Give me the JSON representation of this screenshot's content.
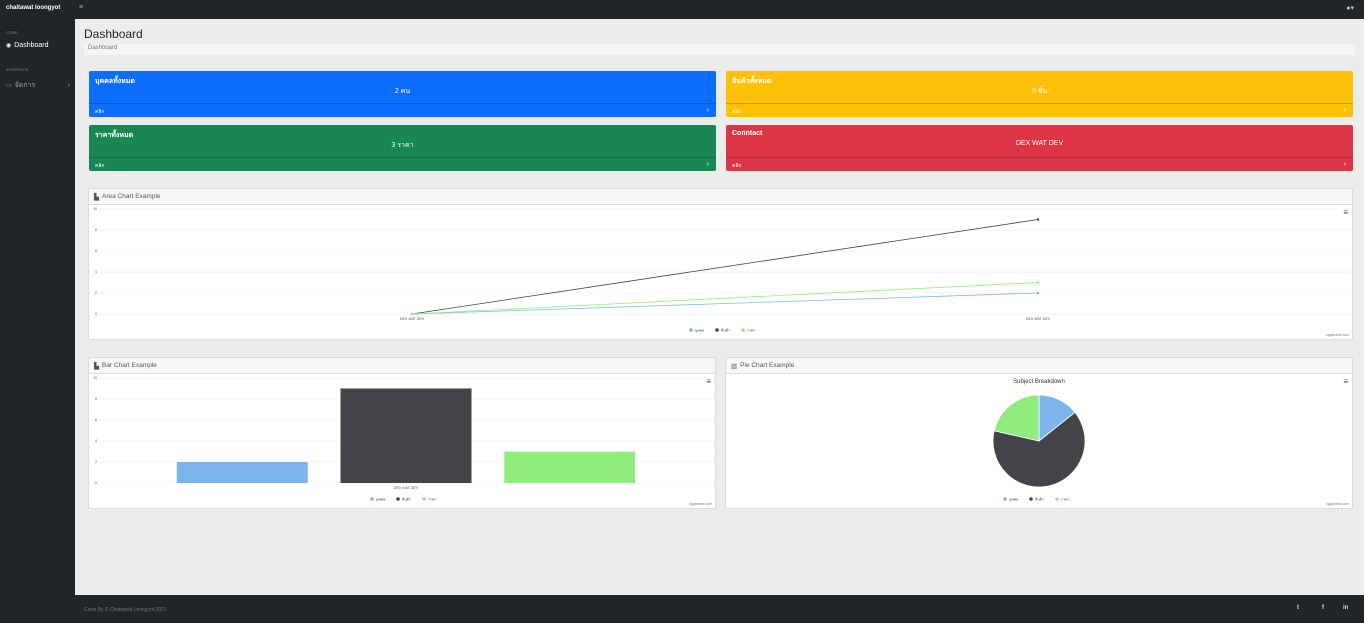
{
  "app": {
    "brand": "chaitawat loongyot"
  },
  "topbar": {
    "toggle_icon": "bars-icon",
    "user_icon": "user-icon"
  },
  "sidebar": {
    "core_heading": "CORE",
    "dashboard_label": "Dashboard",
    "interface_heading": "INTERFACE",
    "manage_label": "จัดการ"
  },
  "page": {
    "title": "Dashboard",
    "breadcrumb": "Dashboard"
  },
  "cards": [
    {
      "title": "บุคคลทั้งหมด",
      "value": "2 คน",
      "footer": "คลิก",
      "color": "#0d6efd"
    },
    {
      "title": "สินค้าทั้งหมด",
      "value": "0 ชิ้น",
      "footer": "คลิก",
      "color": "#ffc107"
    },
    {
      "title": "ราคาทั้งหมด",
      "value": "3 ราคา",
      "footer": "คลิก",
      "color": "#198754"
    },
    {
      "title": "Conntact",
      "value": "DEX WAT DEV",
      "footer": "คลิก",
      "color": "#dc3545"
    }
  ],
  "panels": {
    "area_title": "Area Chart Example",
    "bar_title": "Bar Chart Example",
    "pie_title": "Pie Chart Example",
    "credit": "zygarome.com"
  },
  "chart_data": [
    {
      "type": "line",
      "title": "",
      "x": [
        "DEX WAT DEV",
        "DEX WAT DEV"
      ],
      "series": [
        {
          "name": "บุคคล",
          "values": [
            0,
            2
          ],
          "color": "#7cb5ec"
        },
        {
          "name": "สินค้า",
          "values": [
            0,
            9
          ],
          "color": "#434348"
        },
        {
          "name": "ราคา",
          "values": [
            0,
            3
          ],
          "color": "#90ed7d"
        }
      ],
      "yticks": [
        "0",
        "2",
        "4",
        "6",
        "8",
        "10"
      ],
      "ylim": [
        0,
        10
      ],
      "grid": true,
      "legend": "bottom-center"
    },
    {
      "type": "bar",
      "title": "",
      "categories": [
        "DEX WAT DEV"
      ],
      "series": [
        {
          "name": "บุคคล",
          "values": [
            2
          ],
          "color": "#7cb5ec"
        },
        {
          "name": "สินค้า",
          "values": [
            9
          ],
          "color": "#434348"
        },
        {
          "name": "ราคา",
          "values": [
            3
          ],
          "color": "#90ed7d"
        }
      ],
      "yticks": [
        "0",
        "2",
        "4",
        "6",
        "8",
        "10"
      ],
      "ylim": [
        0,
        10
      ],
      "grid": true,
      "legend": "bottom-center"
    },
    {
      "type": "pie",
      "title": "Subject Breakdown",
      "slices": [
        {
          "name": "บุคคล",
          "value": 2,
          "color": "#7cb5ec"
        },
        {
          "name": "สินค้า",
          "value": 9,
          "color": "#434348"
        },
        {
          "name": "ราคา",
          "value": 3,
          "color": "#90ed7d"
        }
      ],
      "legend": "bottom-center"
    }
  ],
  "footer": {
    "copyright": "Creat By © Chaitawat Loongyot 2021",
    "social": [
      "t",
      "f",
      "in"
    ]
  }
}
